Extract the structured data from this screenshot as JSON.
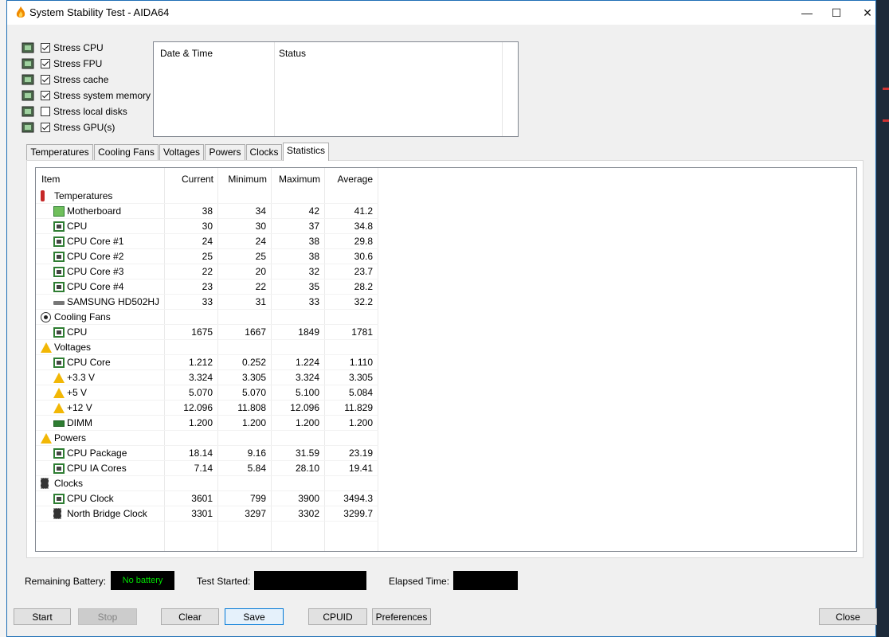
{
  "window": {
    "title": "System Stability Test - AIDA64"
  },
  "stress_options": [
    {
      "label": "Stress CPU",
      "checked": true,
      "icon": "cpu-icon"
    },
    {
      "label": "Stress FPU",
      "checked": true,
      "icon": "fpu-icon"
    },
    {
      "label": "Stress cache",
      "checked": true,
      "icon": "cache-icon"
    },
    {
      "label": "Stress system memory",
      "checked": true,
      "icon": "memory-icon"
    },
    {
      "label": "Stress local disks",
      "checked": false,
      "icon": "disk-icon"
    },
    {
      "label": "Stress GPU(s)",
      "checked": true,
      "icon": "gpu-icon"
    }
  ],
  "log": {
    "col_datetime": "Date & Time",
    "col_status": "Status"
  },
  "tabs": [
    "Temperatures",
    "Cooling Fans",
    "Voltages",
    "Powers",
    "Clocks",
    "Statistics"
  ],
  "active_tab": "Statistics",
  "stats": {
    "headers": {
      "item": "Item",
      "current": "Current",
      "minimum": "Minimum",
      "maximum": "Maximum",
      "average": "Average"
    },
    "rows": [
      {
        "type": "group",
        "label": "Temperatures",
        "icon": "thermometer"
      },
      {
        "type": "item",
        "label": "Motherboard",
        "icon": "motherboard",
        "current": "38",
        "minimum": "34",
        "maximum": "42",
        "average": "41.2"
      },
      {
        "type": "item",
        "label": "CPU",
        "icon": "chip",
        "current": "30",
        "minimum": "30",
        "maximum": "37",
        "average": "34.8"
      },
      {
        "type": "item",
        "label": "CPU Core #1",
        "icon": "chip",
        "current": "24",
        "minimum": "24",
        "maximum": "38",
        "average": "29.8"
      },
      {
        "type": "item",
        "label": "CPU Core #2",
        "icon": "chip",
        "current": "25",
        "minimum": "25",
        "maximum": "38",
        "average": "30.6"
      },
      {
        "type": "item",
        "label": "CPU Core #3",
        "icon": "chip",
        "current": "22",
        "minimum": "20",
        "maximum": "32",
        "average": "23.7"
      },
      {
        "type": "item",
        "label": "CPU Core #4",
        "icon": "chip",
        "current": "23",
        "minimum": "22",
        "maximum": "35",
        "average": "28.2"
      },
      {
        "type": "item",
        "label": "SAMSUNG HD502HJ",
        "icon": "hdd",
        "current": "33",
        "minimum": "31",
        "maximum": "33",
        "average": "32.2"
      },
      {
        "type": "group",
        "label": "Cooling Fans",
        "icon": "fan"
      },
      {
        "type": "item",
        "label": "CPU",
        "icon": "chip",
        "current": "1675",
        "minimum": "1667",
        "maximum": "1849",
        "average": "1781"
      },
      {
        "type": "group",
        "label": "Voltages",
        "icon": "warning"
      },
      {
        "type": "item",
        "label": "CPU Core",
        "icon": "chip",
        "current": "1.212",
        "minimum": "0.252",
        "maximum": "1.224",
        "average": "1.110"
      },
      {
        "type": "item",
        "label": "+3.3 V",
        "icon": "warning",
        "current": "3.324",
        "minimum": "3.305",
        "maximum": "3.324",
        "average": "3.305"
      },
      {
        "type": "item",
        "label": "+5 V",
        "icon": "warning",
        "current": "5.070",
        "minimum": "5.070",
        "maximum": "5.100",
        "average": "5.084"
      },
      {
        "type": "item",
        "label": "+12 V",
        "icon": "warning",
        "current": "12.096",
        "minimum": "11.808",
        "maximum": "12.096",
        "average": "11.829"
      },
      {
        "type": "item",
        "label": "DIMM",
        "icon": "dimm",
        "current": "1.200",
        "minimum": "1.200",
        "maximum": "1.200",
        "average": "1.200"
      },
      {
        "type": "group",
        "label": "Powers",
        "icon": "warning"
      },
      {
        "type": "item",
        "label": "CPU Package",
        "icon": "chip",
        "current": "18.14",
        "minimum": "9.16",
        "maximum": "31.59",
        "average": "23.19"
      },
      {
        "type": "item",
        "label": "CPU IA Cores",
        "icon": "chip",
        "current": "7.14",
        "minimum": "5.84",
        "maximum": "28.10",
        "average": "19.41"
      },
      {
        "type": "group",
        "label": "Clocks",
        "icon": "clock"
      },
      {
        "type": "item",
        "label": "CPU Clock",
        "icon": "chip",
        "current": "3601",
        "minimum": "799",
        "maximum": "3900",
        "average": "3494.3"
      },
      {
        "type": "item",
        "label": "North Bridge Clock",
        "icon": "clock",
        "current": "3301",
        "minimum": "3297",
        "maximum": "3302",
        "average": "3299.7"
      }
    ]
  },
  "status_bar": {
    "battery_label": "Remaining Battery:",
    "battery_value": "No battery",
    "test_started_label": "Test Started:",
    "test_started_value": "",
    "elapsed_label": "Elapsed Time:",
    "elapsed_value": ""
  },
  "buttons": {
    "start": "Start",
    "stop": "Stop",
    "clear": "Clear",
    "save": "Save",
    "cpuid": "CPUID",
    "preferences": "Preferences",
    "close": "Close"
  },
  "colors": {
    "accent": "#0078d7",
    "battery_text": "#00e000"
  }
}
